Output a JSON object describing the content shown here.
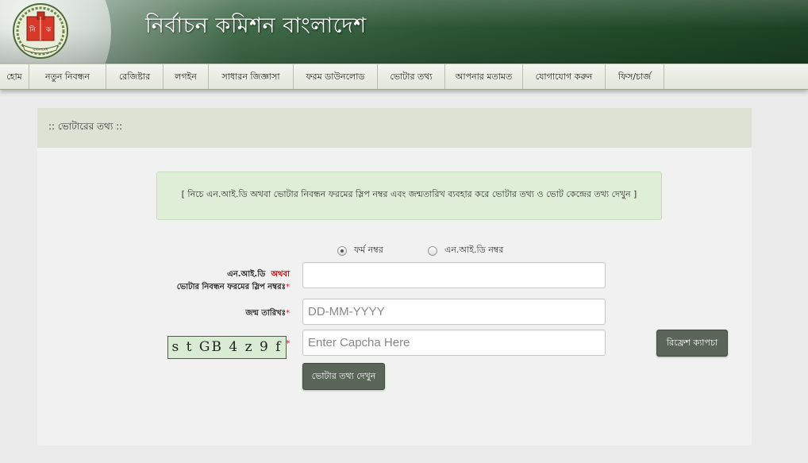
{
  "header": {
    "title": "নির্বাচন কমিশন বাংলাদেশ",
    "logo_text": "বাংলাদেশ",
    "logo_letters": [
      "নি",
      "ক"
    ]
  },
  "nav": {
    "items": [
      {
        "label": "হোম"
      },
      {
        "label": "নতুন নিবন্ধন"
      },
      {
        "label": "রেজিষ্টার"
      },
      {
        "label": "লগইন"
      },
      {
        "label": "সাধারন জিজ্ঞাসা"
      },
      {
        "label": "ফরম ডাউনলোড"
      },
      {
        "label": "ভোটার তথ্য"
      },
      {
        "label": "আপনার মতামত"
      },
      {
        "label": "যোগাযোগ করুন"
      },
      {
        "label": "ফিস/চার্জ"
      }
    ]
  },
  "panel": {
    "heading": ":: ভোটারের তথ্য ::",
    "info": "[ নিচে এন.আই.ডি অথবা ভোটার নিবন্ধন ফরমের স্লিপ নম্বর এবং জন্মতারিখ ব্যবহার করে ভোটার তথ্য ও ভোট কেন্দ্রের তথ্য দেখুন ]"
  },
  "form": {
    "radio_form_label": "ফর্ম নম্বর",
    "radio_nid_label": "এন.আই.ডি নম্বর",
    "selected_radio": "form",
    "id_label_part1": "এন.আই.ডি",
    "id_label_or": "অথবা",
    "id_label_part2": "ভোটার নিবন্ধন ফরমের স্লিপ নম্বরঃ",
    "id_value": "",
    "dob_label": "জন্ম তারিখঃ",
    "dob_placeholder": "DD-MM-YYYY",
    "captcha_text": "s t GB 4 z 9 f",
    "captcha_placeholder": "Enter Capcha Here",
    "required_mark": "*",
    "refresh_button": "রিফ্রেশ ক্যাপচা",
    "submit_button": "ভোটার তথ্য দেখুন"
  },
  "colors": {
    "header_green": "#2b5534",
    "panel_head_bg": "#dde2d5",
    "info_bg": "#dfeed7",
    "button_bg": "#5a6658",
    "required": "#d22222"
  }
}
